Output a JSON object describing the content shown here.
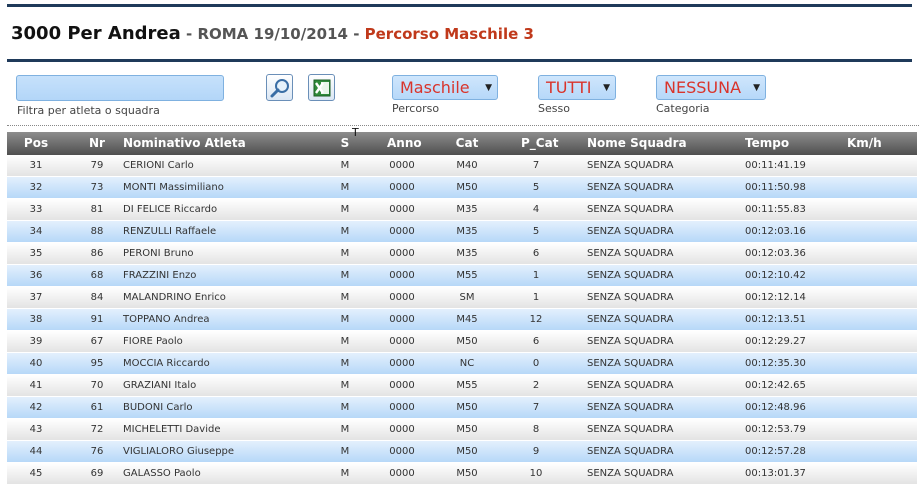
{
  "header": {
    "title": "3000 Per Andrea",
    "separator": " - ",
    "race": "ROMA 19/10/2014",
    "separator2": " - ",
    "percorso": "Percorso Maschile 3"
  },
  "filter": {
    "value": "",
    "label": "Filtra per atleta o squadra"
  },
  "icons": {
    "search": "search-icon",
    "excel": "excel-icon"
  },
  "selects": {
    "percorso": {
      "value": "Maschile",
      "label": "Percorso"
    },
    "sesso": {
      "value": "TUTTI",
      "label": "Sesso"
    },
    "categoria": {
      "value": "NESSUNA",
      "label": "Categoria"
    }
  },
  "table": {
    "headers": {
      "pos": "Pos",
      "nr": "Nr",
      "nome": "Nominativo Atleta",
      "sesso": "S",
      "sort_marker": "T",
      "anno": "Anno",
      "cat": "Cat",
      "pcat": "P_Cat",
      "squadra": "Nome Squadra",
      "tempo": "Tempo",
      "kmh": "Km/h"
    },
    "rows": [
      {
        "pos": "31",
        "nr": "79",
        "nome": "CERIONI Carlo",
        "sesso": "M",
        "anno": "0000",
        "cat": "M40",
        "pcat": "7",
        "squadra": "SENZA SQUADRA",
        "tempo": "00:11:41.19",
        "kmh": ""
      },
      {
        "pos": "32",
        "nr": "73",
        "nome": "MONTI Massimiliano",
        "sesso": "M",
        "anno": "0000",
        "cat": "M50",
        "pcat": "5",
        "squadra": "SENZA SQUADRA",
        "tempo": "00:11:50.98",
        "kmh": ""
      },
      {
        "pos": "33",
        "nr": "81",
        "nome": "DI FELICE Riccardo",
        "sesso": "M",
        "anno": "0000",
        "cat": "M35",
        "pcat": "4",
        "squadra": "SENZA SQUADRA",
        "tempo": "00:11:55.83",
        "kmh": ""
      },
      {
        "pos": "34",
        "nr": "88",
        "nome": "RENZULLI Raffaele",
        "sesso": "M",
        "anno": "0000",
        "cat": "M35",
        "pcat": "5",
        "squadra": "SENZA SQUADRA",
        "tempo": "00:12:03.16",
        "kmh": ""
      },
      {
        "pos": "35",
        "nr": "86",
        "nome": "PERONI Bruno",
        "sesso": "M",
        "anno": "0000",
        "cat": "M35",
        "pcat": "6",
        "squadra": "SENZA SQUADRA",
        "tempo": "00:12:03.36",
        "kmh": ""
      },
      {
        "pos": "36",
        "nr": "68",
        "nome": "FRAZZINI Enzo",
        "sesso": "M",
        "anno": "0000",
        "cat": "M55",
        "pcat": "1",
        "squadra": "SENZA SQUADRA",
        "tempo": "00:12:10.42",
        "kmh": ""
      },
      {
        "pos": "37",
        "nr": "84",
        "nome": "MALANDRINO Enrico",
        "sesso": "M",
        "anno": "0000",
        "cat": "SM",
        "pcat": "1",
        "squadra": "SENZA SQUADRA",
        "tempo": "00:12:12.14",
        "kmh": ""
      },
      {
        "pos": "38",
        "nr": "91",
        "nome": "TOPPANO Andrea",
        "sesso": "M",
        "anno": "0000",
        "cat": "M45",
        "pcat": "12",
        "squadra": "SENZA SQUADRA",
        "tempo": "00:12:13.51",
        "kmh": ""
      },
      {
        "pos": "39",
        "nr": "67",
        "nome": "FIORE Paolo",
        "sesso": "M",
        "anno": "0000",
        "cat": "M50",
        "pcat": "6",
        "squadra": "SENZA SQUADRA",
        "tempo": "00:12:29.27",
        "kmh": ""
      },
      {
        "pos": "40",
        "nr": "95",
        "nome": "MOCCIA Riccardo",
        "sesso": "M",
        "anno": "0000",
        "cat": "NC",
        "pcat": "0",
        "squadra": "SENZA SQUADRA",
        "tempo": "00:12:35.30",
        "kmh": ""
      },
      {
        "pos": "41",
        "nr": "70",
        "nome": "GRAZIANI Italo",
        "sesso": "M",
        "anno": "0000",
        "cat": "M55",
        "pcat": "2",
        "squadra": "SENZA SQUADRA",
        "tempo": "00:12:42.65",
        "kmh": ""
      },
      {
        "pos": "42",
        "nr": "61",
        "nome": "BUDONI Carlo",
        "sesso": "M",
        "anno": "0000",
        "cat": "M50",
        "pcat": "7",
        "squadra": "SENZA SQUADRA",
        "tempo": "00:12:48.96",
        "kmh": ""
      },
      {
        "pos": "43",
        "nr": "72",
        "nome": "MICHELETTI Davide",
        "sesso": "M",
        "anno": "0000",
        "cat": "M50",
        "pcat": "8",
        "squadra": "SENZA SQUADRA",
        "tempo": "00:12:53.79",
        "kmh": ""
      },
      {
        "pos": "44",
        "nr": "76",
        "nome": "VIGLIALORO Giuseppe",
        "sesso": "M",
        "anno": "0000",
        "cat": "M50",
        "pcat": "9",
        "squadra": "SENZA SQUADRA",
        "tempo": "00:12:57.28",
        "kmh": ""
      },
      {
        "pos": "45",
        "nr": "69",
        "nome": "GALASSO Paolo",
        "sesso": "M",
        "anno": "0000",
        "cat": "M50",
        "pcat": "10",
        "squadra": "SENZA SQUADRA",
        "tempo": "00:13:01.37",
        "kmh": ""
      }
    ]
  },
  "colors": {
    "accent_rule": "#1f3a5a",
    "percorso_text": "#c0391b",
    "select_value": "#d9342b",
    "row_blue": "#b7d8f8",
    "header_bg": "#4f4f4f"
  }
}
